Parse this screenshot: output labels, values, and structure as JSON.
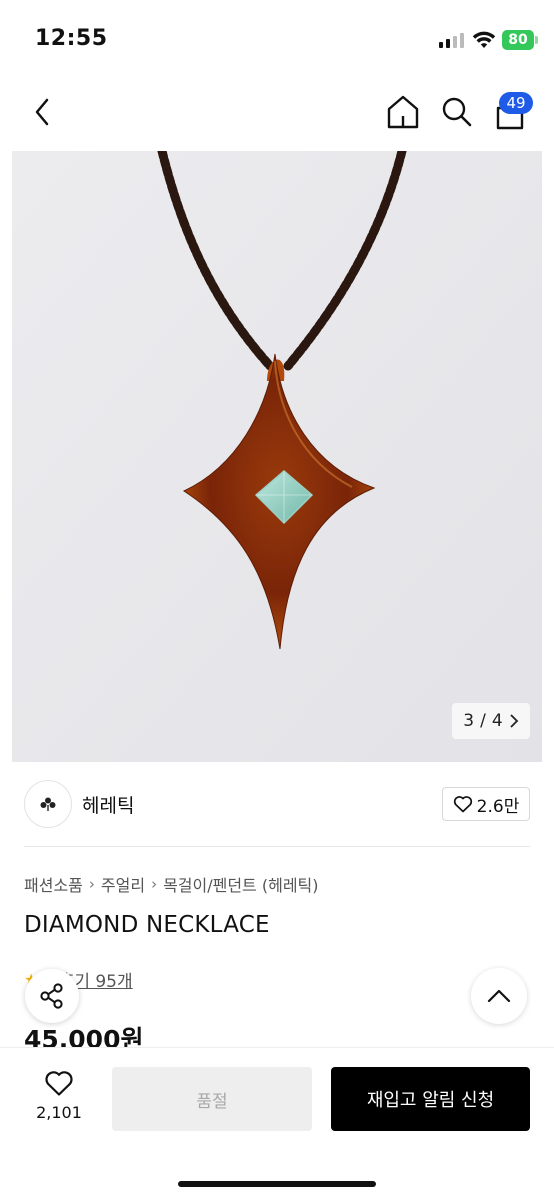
{
  "status_bar": {
    "time": "12:55",
    "battery": "80"
  },
  "nav": {
    "cart_count": "49"
  },
  "image": {
    "counter_current": "3",
    "counter_sep": "/",
    "counter_total": "4"
  },
  "brand": {
    "name": "헤레틱",
    "likes": "2.6만"
  },
  "breadcrumb": [
    "패션소품",
    "주얼리",
    "목걸이/펜던트 (헤레틱)"
  ],
  "product": {
    "title": "DIAMOND NECKLACE",
    "review_label": "후기 95개",
    "price": "45,000원"
  },
  "bottom": {
    "like_count": "2,101",
    "soldout_label": "품절",
    "restock_label": "재입고 알림 신청"
  }
}
